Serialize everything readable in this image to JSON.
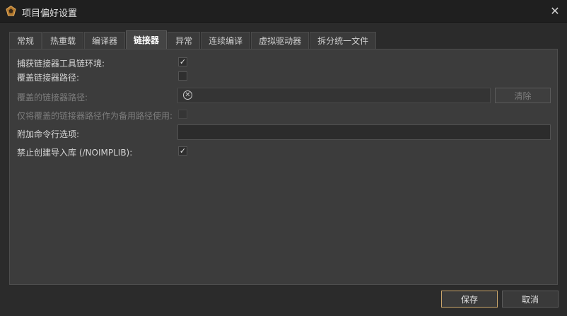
{
  "window": {
    "title": "项目偏好设置",
    "icon": "pentagon-app-icon",
    "close_icon": "close-x"
  },
  "tabs": [
    {
      "label": "常规",
      "active": false
    },
    {
      "label": "热重载",
      "active": false
    },
    {
      "label": "编译器",
      "active": false
    },
    {
      "label": "链接器",
      "active": true
    },
    {
      "label": "异常",
      "active": false
    },
    {
      "label": "连续编译",
      "active": false
    },
    {
      "label": "虚拟驱动器",
      "active": false
    },
    {
      "label": "拆分统一文件",
      "active": false
    }
  ],
  "settings": {
    "capture_linker_env": {
      "label": "捕获链接器工具链环境:",
      "checked": true
    },
    "override_linker_path": {
      "label": "覆盖链接器路径:",
      "checked": false
    },
    "overridden_linker_path": {
      "label": "覆盖的链接器路径:",
      "value": "",
      "clear_label": "清除"
    },
    "only_use_as_fallback": {
      "label": "仅将覆盖的链接器路径作为备用路径使用:",
      "checked": false
    },
    "additional_cmdline": {
      "label": "附加命令行选项:",
      "value": ""
    },
    "disable_import_lib": {
      "label": "禁止创建导入库 (/NOIMPLIB):",
      "checked": true
    }
  },
  "footer": {
    "save_label": "保存",
    "cancel_label": "取消"
  },
  "colors": {
    "background": "#2b2b2b",
    "panel": "#3c3c3c",
    "accent_border": "#c9a56a"
  }
}
